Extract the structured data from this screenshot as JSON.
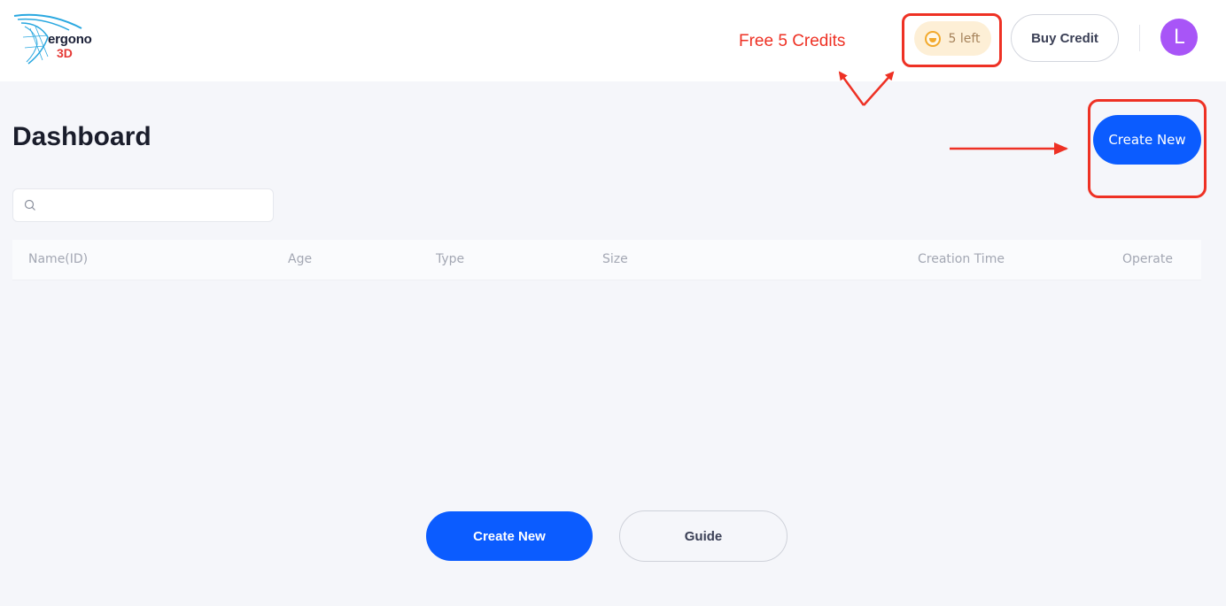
{
  "header": {
    "logo_line1": "ergono",
    "logo_line2": "3D",
    "credits_label": "5 left",
    "buy_credit_label": "Buy Credit",
    "avatar_initial": "L"
  },
  "annotations": {
    "free_credits": "Free 5 Credits"
  },
  "main": {
    "title": "Dashboard",
    "create_new_label": "Create New",
    "search": {
      "placeholder": "",
      "value": ""
    },
    "table": {
      "columns": [
        "Name(ID)",
        "Age",
        "Type",
        "Size",
        "Creation Time",
        "Operate"
      ]
    },
    "empty_actions": {
      "create_new_label": "Create New",
      "guide_label": "Guide"
    }
  },
  "colors": {
    "primary": "#0b5cff",
    "annotation": "#ee3124",
    "avatar": "#a855f7",
    "credits_bg": "#fdefd6"
  }
}
